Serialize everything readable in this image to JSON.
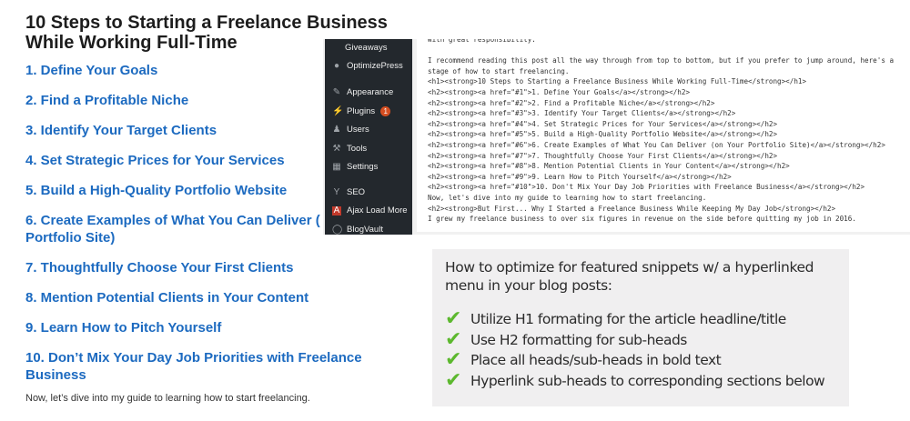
{
  "article": {
    "title": "10 Steps to Starting a Freelance Business While Working Full-Time",
    "toc": [
      "1. Define Your Goals",
      "2. Find a Profitable Niche",
      "3. Identify Your Target Clients",
      "4. Set Strategic Prices for Your Services",
      "5. Build a High-Quality Portfolio Website",
      "6. Create Examples of What You Can Deliver ( Portfolio Site)",
      "7. Thoughtfully Choose Your First Clients",
      "8. Mention Potential Clients in Your Content",
      "9. Learn How to Pitch Yourself",
      "10. Don’t Mix Your Day Job Priorities with Freelance Business"
    ],
    "intro": "Now, let’s dive into my guide to learning how to start freelancing.",
    "link_color": "#1c6ac0"
  },
  "wp_sidebar": {
    "items": [
      {
        "label": "Giveaways",
        "icon": "gift-icon"
      },
      {
        "label": "OptimizePress",
        "icon": "optimizepress-icon"
      },
      {
        "label": "Appearance",
        "icon": "brush-icon"
      },
      {
        "label": "Plugins",
        "icon": "plugin-icon",
        "badge": "1"
      },
      {
        "label": "Users",
        "icon": "user-icon"
      },
      {
        "label": "Tools",
        "icon": "wrench-icon"
      },
      {
        "label": "Settings",
        "icon": "settings-icon"
      },
      {
        "label": "SEO",
        "icon": "yoast-icon"
      },
      {
        "label": "Ajax Load More",
        "icon": "ajax-icon"
      },
      {
        "label": "BlogVault",
        "icon": "blogvault-icon"
      }
    ]
  },
  "editor": {
    "lines": [
      "With great responsibility.",
      "",
      "I recommend reading this post all the way through from top to bottom, but if you prefer to jump around, here's a",
      "stage of how to start freelancing.",
      "<h1><strong>10 Steps to Starting a Freelance Business While Working Full-Time</strong></h1>",
      "<h2><strong><a href=\"#1\">1. Define Your Goals</a></strong></h2>",
      "<h2><strong><a href=\"#2\">2. Find a Profitable Niche</a></strong></h2>",
      "<h2><strong><a href=\"#3\">3. Identify Your Target Clients</a></strong></h2>",
      "<h2><strong><a href=\"#4\">4. Set Strategic Prices for Your Services</a></strong></h2>",
      "<h2><strong><a href=\"#5\">5. Build a High-Quality Portfolio Website</a></strong></h2>",
      "<h2><strong><a href=\"#6\">6. Create Examples of What You Can Deliver (on Your Portfolio Site)</a></strong></h2>",
      "<h2><strong><a href=\"#7\">7. Thoughtfully Choose Your First Clients</a></strong></h2>",
      "<h2><strong><a href=\"#8\">8. Mention Potential Clients in Your Content</a></strong></h2>",
      "<h2><strong><a href=\"#9\">9. Learn How to Pitch Yourself</a></strong></h2>",
      "<h2><strong><a href=\"#10\">10. Don't Mix Your Day Job Priorities with Freelance Business</a></strong></h2>",
      "Now, let's dive into my guide to learning how to start freelancing.",
      "<h2><strong>But First... Why I Started a Freelance Business While Keeping My Day Job</strong></h2>",
      "I grew my freelance business to over six figures in revenue on the side before quitting my job in 2016."
    ]
  },
  "tips": {
    "heading": "How to optimize for featured snippets w/ a hyperlinked menu in your blog posts:",
    "items": [
      "Utilize H1 formating for the article headline/title",
      "Use H2 formatting for sub-heads",
      "Place all heads/sub-heads in bold text",
      "Hyperlink sub-heads to corresponding sections below"
    ],
    "check_color": "#5cb82e"
  }
}
